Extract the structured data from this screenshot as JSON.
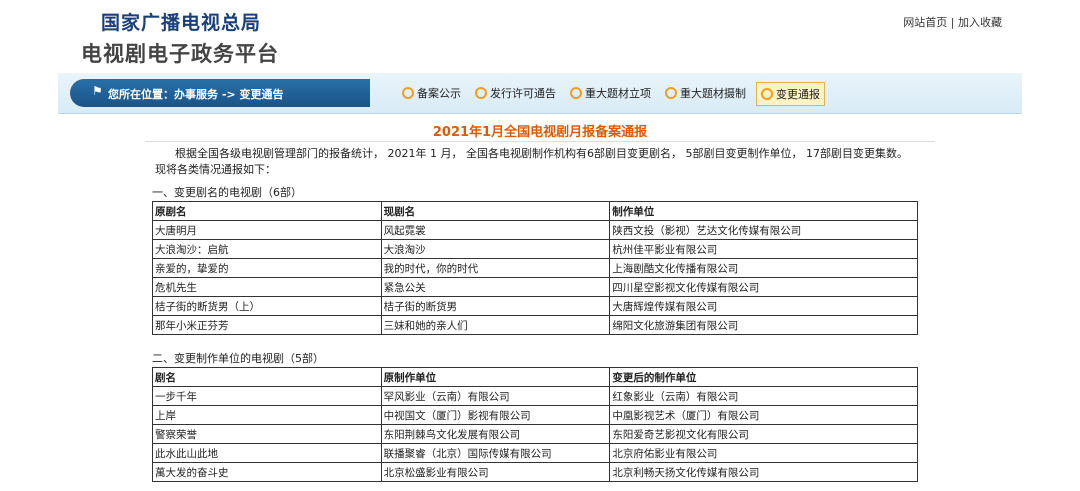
{
  "header": {
    "agency": "国家广播电视总局",
    "platform": "电视剧电子政务平台",
    "links": [
      "网站首页",
      "加入收藏"
    ]
  },
  "nav": {
    "location": "您所在位置：办事服务 -> 变更通告",
    "tabs": [
      {
        "label": "备案公示",
        "active": false
      },
      {
        "label": "发行许可通告",
        "active": false
      },
      {
        "label": "重大题材立项",
        "active": false
      },
      {
        "label": "重大题材摄制",
        "active": false
      },
      {
        "label": "变更通报",
        "active": true
      }
    ]
  },
  "report": {
    "title": "2021年1月全国电视剧月报备案通报",
    "intro": "根据全国各级电视剧管理部门的报备统计， 2021年 1 月， 全国各电视剧制作机构有6部剧目变更剧名， 5部剧目变更制作单位， 17部剧目变更集数。 现将各类情况通报如下：",
    "section1": "一、变更剧名的电视剧（6部）",
    "table1": {
      "headers": [
        "原剧名",
        "现剧名",
        "制作单位"
      ],
      "rows": [
        [
          "大唐明月",
          "风起霓裳",
          "陕西文投（影视）艺达文化传媒有限公司"
        ],
        [
          "大浪淘沙：启航",
          "大浪淘沙",
          "杭州佳平影业有限公司"
        ],
        [
          "亲爱的，挚爱的",
          "我的时代，你的时代",
          "上海剧酷文化传播有限公司"
        ],
        [
          "危机先生",
          "紧急公关",
          "四川星空影视文化传媒有限公司"
        ],
        [
          "桔子街的断货男（上）",
          "桔子街的断货男",
          "大唐辉煌传媒有限公司"
        ],
        [
          "那年小米正芬芳",
          "三妹和她的亲人们",
          "绵阳文化旅游集团有限公司"
        ]
      ]
    },
    "section2": "二、变更制作单位的电视剧（5部）",
    "table2": {
      "headers": [
        "剧名",
        "原制作单位",
        "变更后的制作单位"
      ],
      "rows": [
        [
          "一步千年",
          "罕风影业（云南）有限公司",
          "红象影业（云南）有限公司"
        ],
        [
          "上岸",
          "中视国文（厦门）影视有限公司",
          "中凰影视艺术（厦门）有限公司"
        ],
        [
          "警察荣誉",
          "东阳荆棘鸟文化发展有限公司",
          "东阳爱奇艺影视文化有限公司"
        ],
        [
          "此水此山此地",
          "联播聚睿（北京）国际传媒有限公司",
          "北京府佑影业有限公司"
        ],
        [
          "萬大发的奋斗史",
          "北京松盛影业有限公司",
          "北京利畅天扬文化传媒有限公司"
        ]
      ]
    }
  }
}
